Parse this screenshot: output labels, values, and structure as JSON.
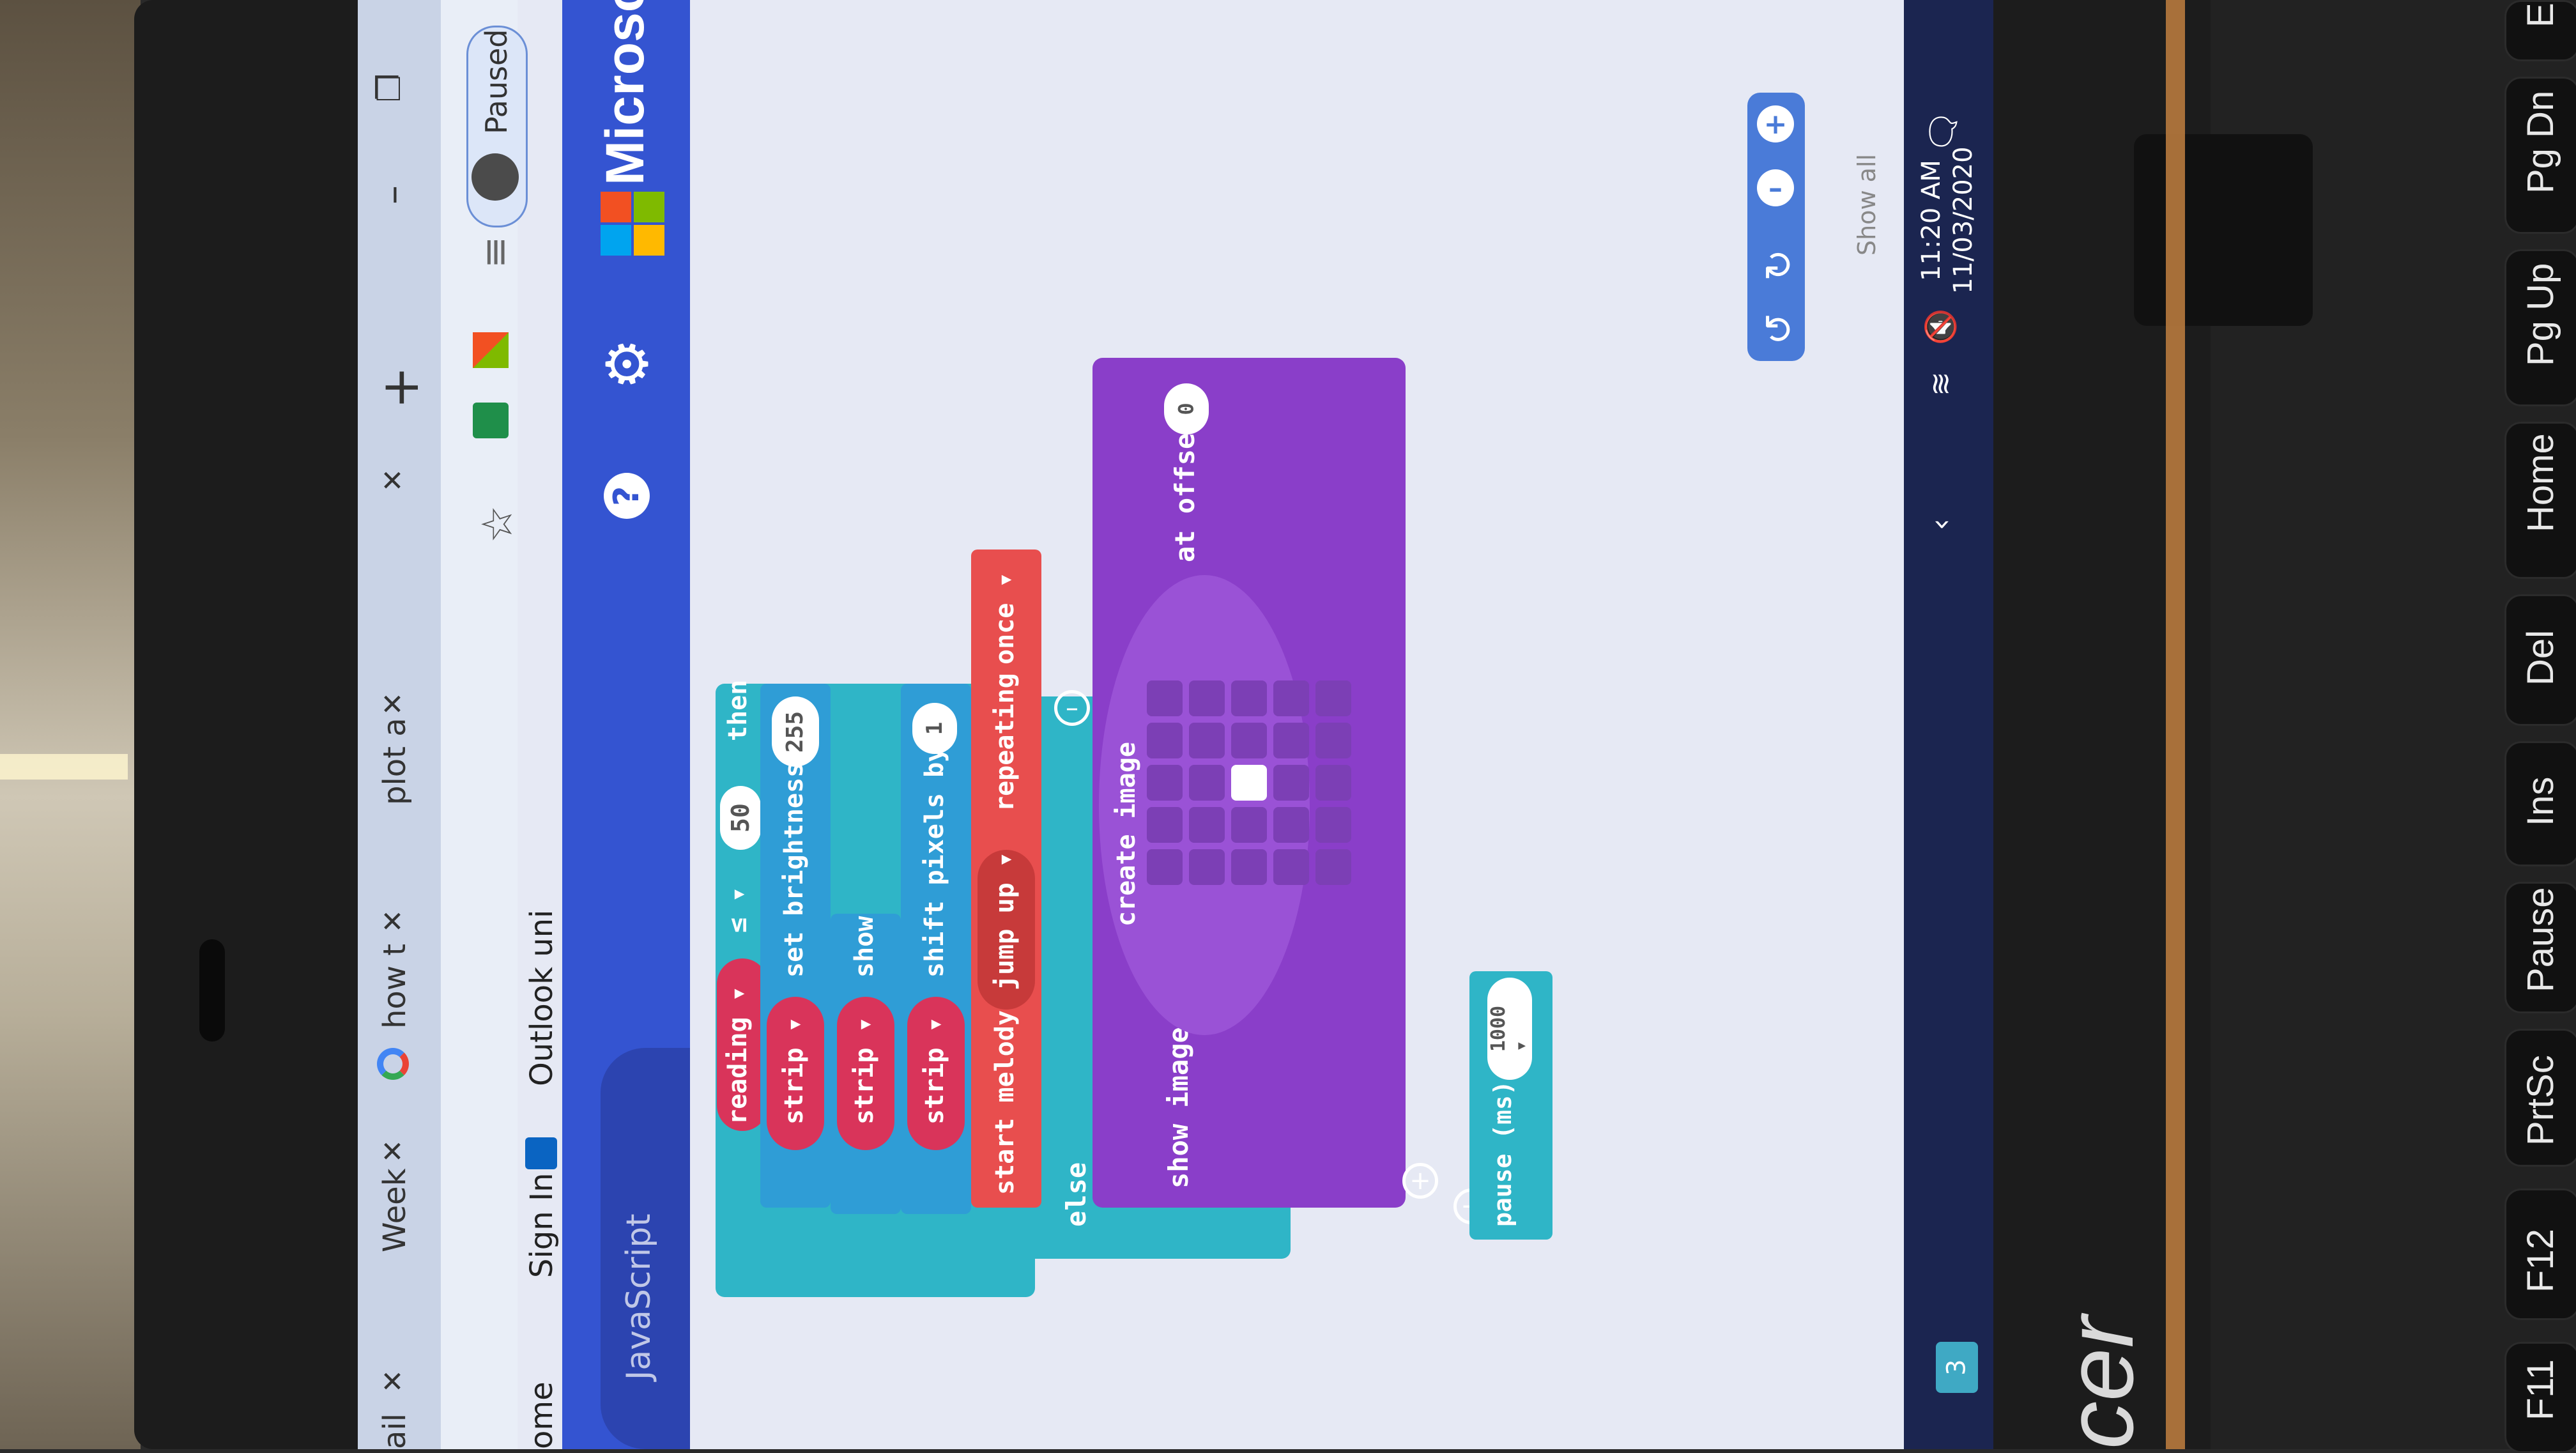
{
  "browser": {
    "tabs": [
      {
        "label": "ail",
        "close": "✕"
      },
      {
        "label": "Week",
        "close": "✕"
      },
      {
        "label": "how t",
        "close": "✕"
      },
      {
        "label": "plot a",
        "close": "✕"
      },
      {
        "label": "",
        "close": "✕"
      }
    ],
    "new_tab": "+",
    "minimize": "–",
    "restore": "❐",
    "profile_status": "Paused",
    "bookmarks": [
      "ome",
      "Sign In",
      "Outlook uni"
    ]
  },
  "makecode": {
    "header_brand": "Microsof",
    "help_glyph": "?",
    "mode_label": "JavaScript",
    "blocks": {
      "if_reading": "reading ▾",
      "compare_op": "≤ ▾",
      "threshold": "50",
      "then": "then",
      "strip1": "strip ▾",
      "set_brightness": "set brightness",
      "brightness_value": "255",
      "strip2": "strip ▾",
      "show": "show",
      "strip3": "strip ▾",
      "shift_pixels": "shift pixels by",
      "shift_value": "1",
      "start_melody": "start melody",
      "melody": "jump up ▾",
      "repeating": "repeating",
      "repeat_mode": "once ▾",
      "else": "else",
      "show_image": "show image",
      "create_image": "create image",
      "at_offset": "at offset",
      "offset_value": "0",
      "pause": "pause (ms)",
      "pause_value": "1000 ▾"
    },
    "image_grid": [
      [
        0,
        0,
        0,
        0,
        0
      ],
      [
        0,
        0,
        0,
        0,
        0
      ],
      [
        0,
        0,
        1,
        0,
        0
      ],
      [
        0,
        0,
        0,
        0,
        0
      ],
      [
        0,
        0,
        0,
        0,
        0
      ]
    ],
    "show_all": "Show all"
  },
  "taskbar": {
    "time": "11:20 AM",
    "date": "11/03/2020",
    "badge": "3"
  },
  "laptop_brand": "cer",
  "keyboard_keys": [
    "F11",
    "F12",
    "PrtSc",
    "Pause",
    "Ins",
    "Del",
    "Home",
    "Pg Up",
    "Pg Dn",
    "E"
  ],
  "colors": {
    "makecode_header": "#3454d1",
    "logic_block": "#2fb5c7",
    "neopixel_block": "#2f9dd6",
    "strip_variable": "#d9345a",
    "music_block": "#e84e4e",
    "image_block": "#8a3ec9",
    "workspace": "#e6e9f4"
  }
}
